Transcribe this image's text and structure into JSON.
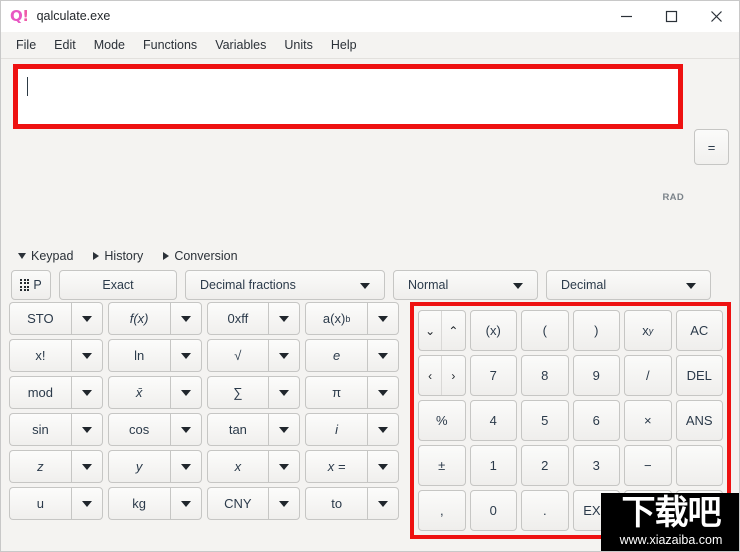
{
  "window": {
    "logo_q": "Q",
    "logo_bang": "!",
    "title": "qalculate.exe",
    "minimize": "minimize",
    "maximize": "maximize",
    "close": "close"
  },
  "menubar": {
    "items": [
      "File",
      "Edit",
      "Mode",
      "Functions",
      "Variables",
      "Units",
      "Help"
    ]
  },
  "expression": {
    "value": "",
    "placeholder": "",
    "equals_label": "=",
    "angle_mode": "RAD"
  },
  "sections": [
    {
      "label": "Keypad",
      "expanded": true
    },
    {
      "label": "History",
      "expanded": false
    },
    {
      "label": "Conversion",
      "expanded": false
    }
  ],
  "options": {
    "keypad_label": "P",
    "exact_label": "Exact",
    "fraction_mode": "Decimal fractions",
    "approximation": "Normal",
    "number_base": "Decimal"
  },
  "left_keypad": {
    "rows": [
      [
        "STO",
        "f(x)",
        "0xff",
        "a(x)b"
      ],
      [
        "x!",
        "ln",
        "√",
        "e"
      ],
      [
        "mod",
        "x̄",
        "∑",
        "π"
      ],
      [
        "sin",
        "cos",
        "tan",
        "i"
      ],
      [
        "z",
        "y",
        "x",
        "x ="
      ],
      [
        "u",
        "kg",
        "CNY",
        "to"
      ]
    ]
  },
  "num_keypad": {
    "rows": [
      [
        "nav-vertical",
        "(x)",
        "(",
        ")",
        "xʸ",
        "AC"
      ],
      [
        "nav-horizontal",
        "7",
        "8",
        "9",
        "/",
        "DEL"
      ],
      [
        "%",
        "4",
        "5",
        "6",
        "×",
        "ANS"
      ],
      [
        "±",
        "1",
        "2",
        "3",
        "−",
        ""
      ],
      [
        ",",
        "0",
        ".",
        "EXP",
        "",
        ""
      ]
    ],
    "nav_vertical": [
      "⌄",
      "⌃"
    ],
    "nav_horizontal": [
      "‹",
      "›"
    ]
  },
  "watermark": {
    "cn_text": "下载吧",
    "url": "www.xiazaiba.com"
  },
  "colors": {
    "annotation_red": "#ee1111",
    "logo_pink": "#e857c3",
    "background": "#f4f3f1",
    "button_text": "#2b3a4a"
  }
}
